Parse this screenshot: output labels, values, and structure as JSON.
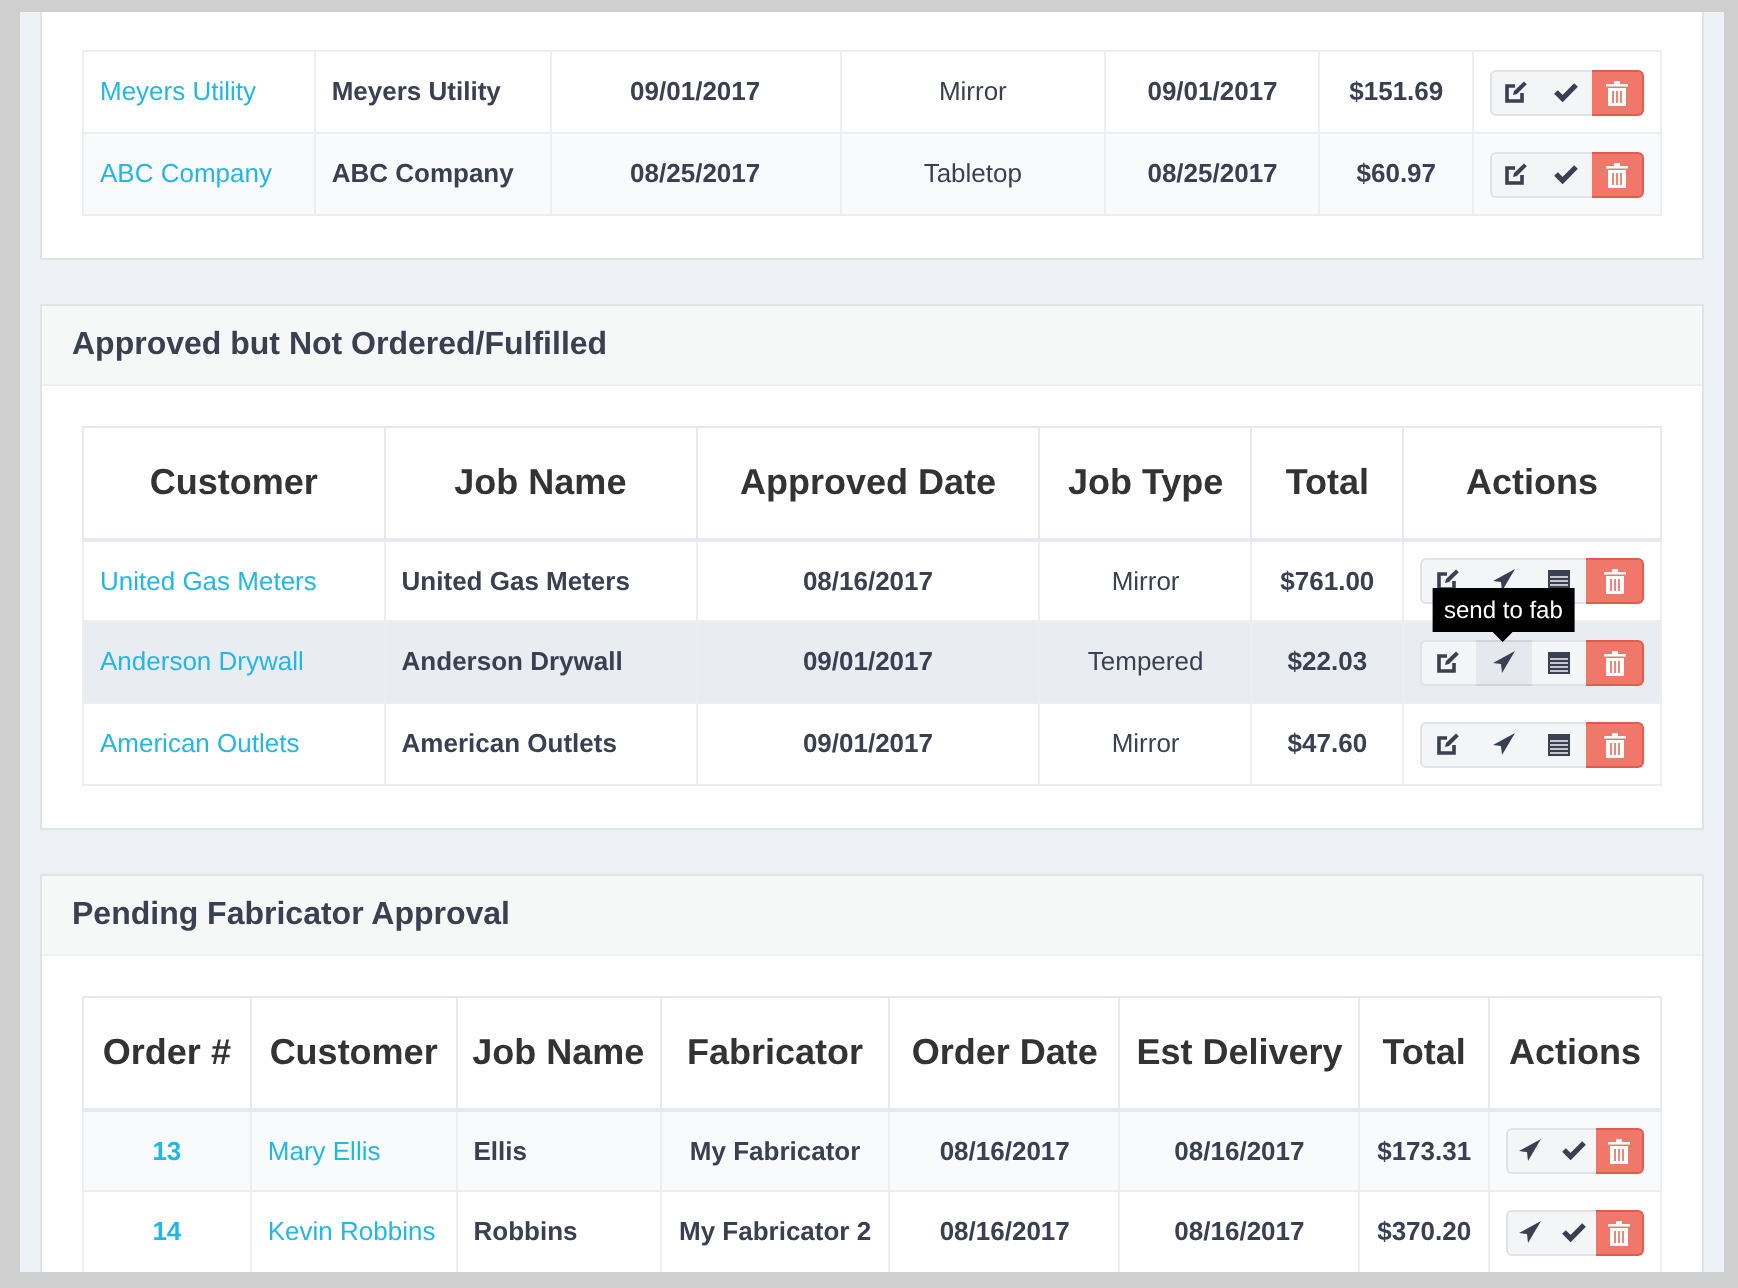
{
  "panels": [
    {
      "table": {
        "rows": [
          {
            "cells": [
              {
                "text": "Meyers Utility",
                "kind": "link"
              },
              {
                "text": "Meyers Utility",
                "kind": "name"
              },
              {
                "text": "09/01/2017",
                "kind": "value"
              },
              {
                "text": "Mirror",
                "kind": "plain"
              },
              {
                "text": "09/01/2017",
                "kind": "value"
              },
              {
                "text": "$151.69",
                "kind": "value"
              }
            ],
            "actions": [
              {
                "kind": "edit"
              },
              {
                "kind": "approve"
              },
              {
                "kind": "delete"
              }
            ]
          },
          {
            "cells": [
              {
                "text": "ABC Company",
                "kind": "link"
              },
              {
                "text": "ABC Company",
                "kind": "name"
              },
              {
                "text": "08/25/2017",
                "kind": "value"
              },
              {
                "text": "Tabletop",
                "kind": "plain"
              },
              {
                "text": "08/25/2017",
                "kind": "value"
              },
              {
                "text": "$60.97",
                "kind": "value"
              }
            ],
            "actions": [
              {
                "kind": "edit"
              },
              {
                "kind": "approve"
              },
              {
                "kind": "delete"
              }
            ]
          }
        ]
      }
    },
    {
      "title": "Approved but Not Ordered/Fulfilled",
      "table": {
        "columns": [
          "Customer",
          "Job Name",
          "Approved Date",
          "Job Type",
          "Total",
          "Actions"
        ],
        "rows": [
          {
            "highlighted": false,
            "cells": [
              {
                "text": "United Gas Meters",
                "kind": "link"
              },
              {
                "text": "United Gas Meters",
                "kind": "name"
              },
              {
                "text": "08/16/2017",
                "kind": "value"
              },
              {
                "text": "Mirror",
                "kind": "plain"
              },
              {
                "text": "$761.00",
                "kind": "value"
              }
            ],
            "actions": [
              {
                "kind": "edit",
                "hovered": false
              },
              {
                "kind": "send",
                "hovered": false
              },
              {
                "kind": "schedule",
                "hovered": false
              },
              {
                "kind": "delete",
                "hovered": false
              }
            ]
          },
          {
            "highlighted": true,
            "cells": [
              {
                "text": "Anderson Drywall",
                "kind": "link"
              },
              {
                "text": "Anderson Drywall",
                "kind": "name"
              },
              {
                "text": "09/01/2017",
                "kind": "value"
              },
              {
                "text": "Tempered",
                "kind": "plain"
              },
              {
                "text": "$22.03",
                "kind": "value"
              }
            ],
            "actions": [
              {
                "kind": "edit",
                "hovered": false
              },
              {
                "kind": "send",
                "hovered": true,
                "tooltip": "send to fab"
              },
              {
                "kind": "schedule",
                "hovered": false
              },
              {
                "kind": "delete",
                "hovered": false
              }
            ]
          },
          {
            "highlighted": false,
            "cells": [
              {
                "text": "American Outlets",
                "kind": "link"
              },
              {
                "text": "American Outlets",
                "kind": "name"
              },
              {
                "text": "09/01/2017",
                "kind": "value"
              },
              {
                "text": "Mirror",
                "kind": "plain"
              },
              {
                "text": "$47.60",
                "kind": "value"
              }
            ],
            "actions": [
              {
                "kind": "edit",
                "hovered": false
              },
              {
                "kind": "send",
                "hovered": false
              },
              {
                "kind": "schedule",
                "hovered": false
              },
              {
                "kind": "delete",
                "hovered": false
              }
            ]
          }
        ]
      }
    },
    {
      "title": "Pending Fabricator Approval",
      "table": {
        "columns": [
          "Order #",
          "Customer",
          "Job Name",
          "Fabricator",
          "Order Date",
          "Est Delivery",
          "Total",
          "Actions"
        ],
        "rows": [
          {
            "cells": [
              {
                "text": "13",
                "kind": "id"
              },
              {
                "text": "Mary Ellis",
                "kind": "link"
              },
              {
                "text": "Ellis",
                "kind": "name"
              },
              {
                "text": "My Fabricator",
                "kind": "value"
              },
              {
                "text": "08/16/2017",
                "kind": "value"
              },
              {
                "text": "08/16/2017",
                "kind": "value"
              },
              {
                "text": "$173.31",
                "kind": "value"
              }
            ],
            "actions": [
              {
                "kind": "send"
              },
              {
                "kind": "approve"
              },
              {
                "kind": "delete"
              }
            ]
          },
          {
            "cells": [
              {
                "text": "14",
                "kind": "id"
              },
              {
                "text": "Kevin Robbins",
                "kind": "link"
              },
              {
                "text": "Robbins",
                "kind": "name"
              },
              {
                "text": "My Fabricator 2",
                "kind": "value"
              },
              {
                "text": "08/16/2017",
                "kind": "value"
              },
              {
                "text": "08/16/2017",
                "kind": "value"
              },
              {
                "text": "$370.20",
                "kind": "value"
              }
            ],
            "actions": [
              {
                "kind": "send"
              },
              {
                "kind": "approve"
              },
              {
                "kind": "delete"
              }
            ]
          }
        ]
      }
    }
  ]
}
